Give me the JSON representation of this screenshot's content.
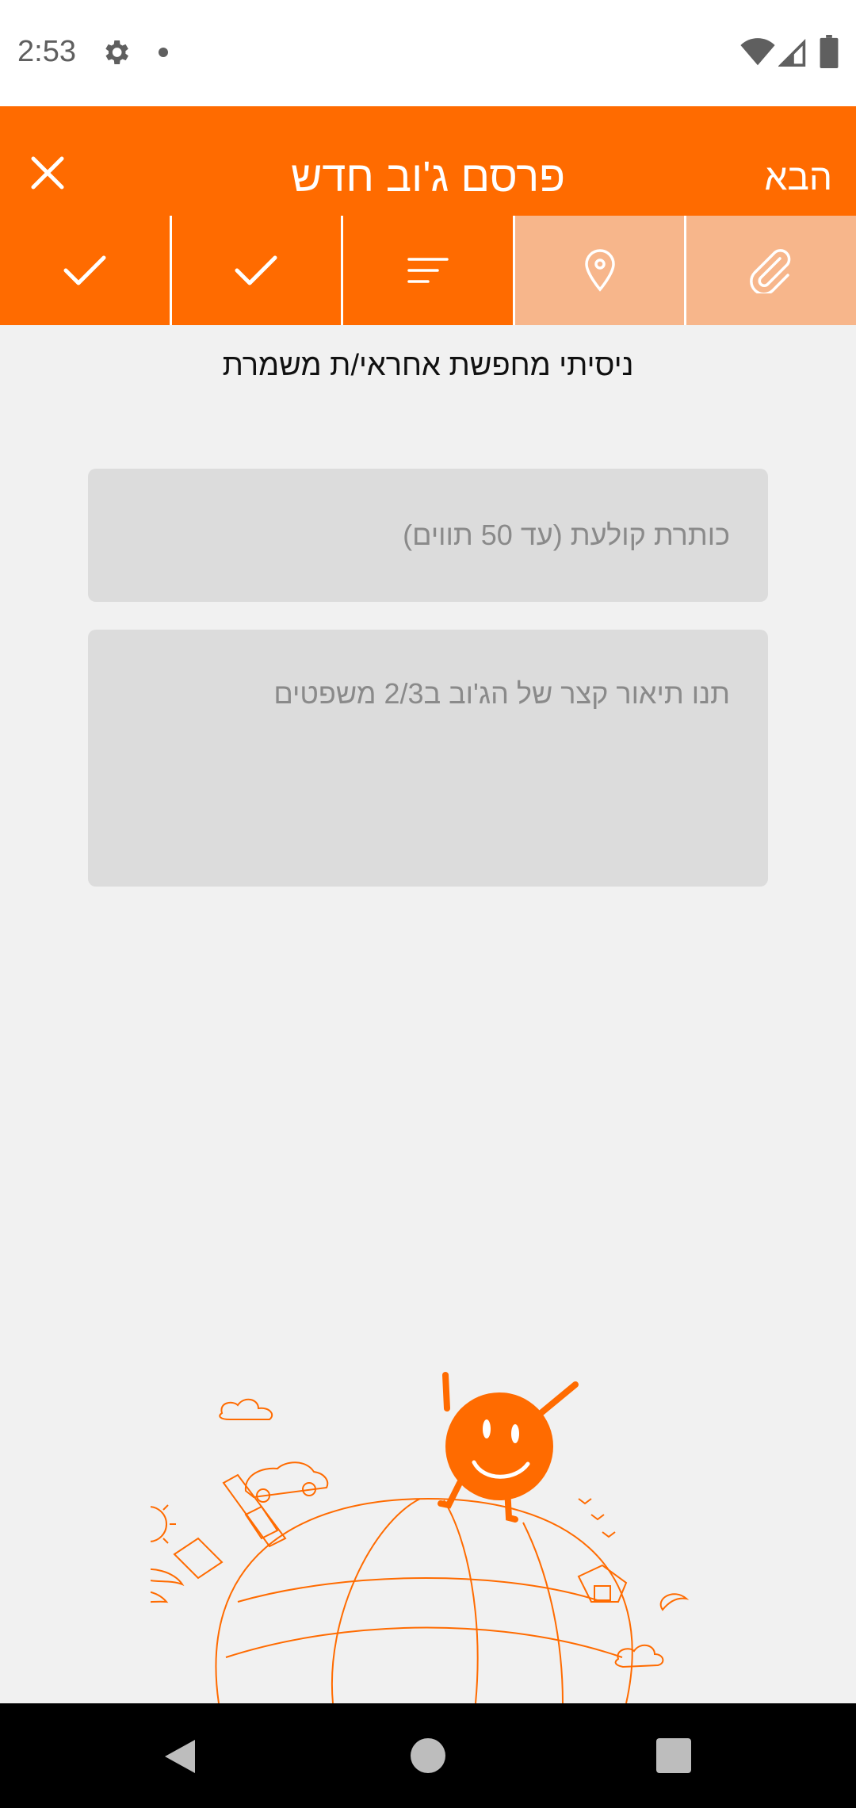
{
  "status_bar": {
    "time": "2:53"
  },
  "app_bar": {
    "title": "פרסם ג'וב חדש",
    "next_label": "הבא"
  },
  "steps": [
    {
      "icon": "check-icon",
      "state": "completed"
    },
    {
      "icon": "check-icon",
      "state": "completed"
    },
    {
      "icon": "text-lines-icon",
      "state": "current"
    },
    {
      "icon": "location-pin-icon",
      "state": "pending"
    },
    {
      "icon": "paperclip-icon",
      "state": "pending"
    }
  ],
  "form": {
    "subtitle": "ניסיתי מחפשת אחראי/ת משמרת",
    "title_placeholder": "כותרת קולעת (עד 50 תווים)",
    "description_placeholder": "תנו תיאור קצר של הג'וב ב2/3 משפטים"
  },
  "colors": {
    "accent": "#ff6b00",
    "accent_light": "#f7b68b",
    "background": "#f1f1f1",
    "field": "#dcdcdc"
  }
}
